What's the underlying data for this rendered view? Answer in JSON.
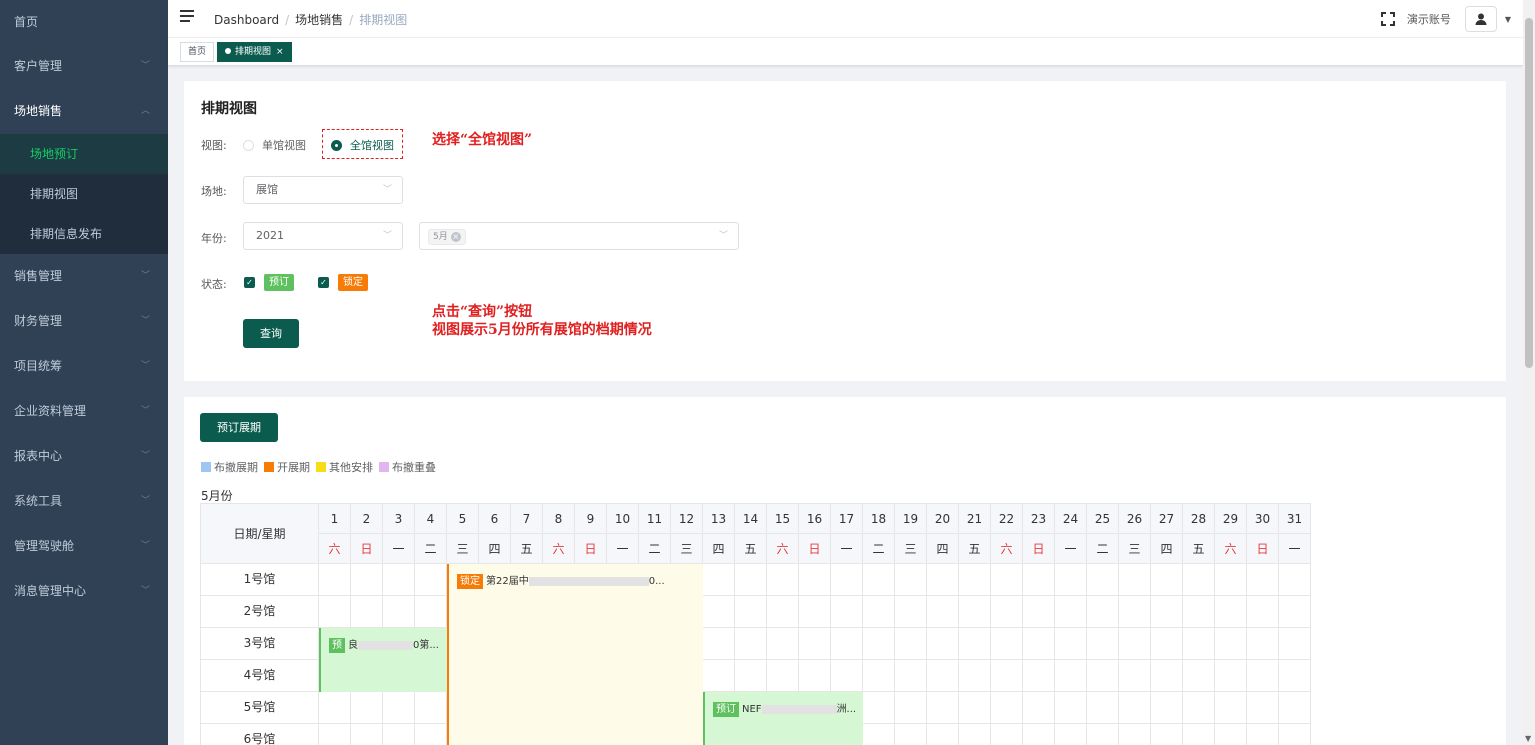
{
  "sidebar": {
    "items": [
      {
        "label": "首页",
        "has_arrow": false
      },
      {
        "label": "客户管理",
        "has_arrow": true
      },
      {
        "label": "场地销售",
        "has_arrow": true,
        "open": true
      },
      {
        "label": "销售管理",
        "has_arrow": true
      },
      {
        "label": "财务管理",
        "has_arrow": true
      },
      {
        "label": "项目统筹",
        "has_arrow": true
      },
      {
        "label": "企业资料管理",
        "has_arrow": true
      },
      {
        "label": "报表中心",
        "has_arrow": true
      },
      {
        "label": "系统工具",
        "has_arrow": true
      },
      {
        "label": "管理驾驶舱",
        "has_arrow": true
      },
      {
        "label": "消息管理中心",
        "has_arrow": true
      }
    ],
    "submenu": [
      "场地预订",
      "排期视图",
      "排期信息发布"
    ],
    "active_sub": "场地预订"
  },
  "header": {
    "breadcrumb": [
      "Dashboard",
      "场地销售",
      "排期视图"
    ],
    "account": "演示账号"
  },
  "tags": [
    {
      "label": "首页",
      "active": false
    },
    {
      "label": "排期视图",
      "active": true,
      "closable": "×"
    }
  ],
  "filter": {
    "title": "排期视图",
    "view_label": "视图:",
    "view_options": [
      "单馆视图",
      "全馆视图"
    ],
    "view_selected": "全馆视图",
    "annot_select": "选择“全馆视图”",
    "venue_label": "场地:",
    "venue_value": "展馆",
    "year_label": "年份:",
    "year_value": "2021",
    "month_chip": "5月",
    "status_label": "状态:",
    "status_options": [
      "预订",
      "锁定"
    ],
    "query_button": "查询",
    "annot_query_1": "点击“查询”按钮",
    "annot_query_2": "视图展示5月份所有展馆的档期情况",
    "colors": {
      "primary": "#0b5c4e",
      "booked": "#5ec05e",
      "locked": "#f77b07",
      "annotation": "#e02020"
    }
  },
  "schedule": {
    "book_button": "预订展期",
    "legend": [
      {
        "label": "布撤展期",
        "color": "#9ec6f0"
      },
      {
        "label": "开展期",
        "color": "#f77b07"
      },
      {
        "label": "其他安排",
        "color": "#f7dc1a"
      },
      {
        "label": "布撤重叠",
        "color": "#e5b3f0"
      }
    ],
    "month_label": "5月份",
    "corner_label": "日期/星期",
    "days": [
      "1",
      "2",
      "3",
      "4",
      "5",
      "6",
      "7",
      "8",
      "9",
      "10",
      "11",
      "12",
      "13",
      "14",
      "15",
      "16",
      "17",
      "18",
      "19",
      "20",
      "21",
      "22",
      "23",
      "24",
      "25",
      "26",
      "27",
      "28",
      "29",
      "30",
      "31"
    ],
    "weekdays": [
      "六",
      "日",
      "一",
      "二",
      "三",
      "四",
      "五",
      "六",
      "日",
      "一",
      "二",
      "三",
      "四",
      "五",
      "六",
      "日",
      "一",
      "二",
      "三",
      "四",
      "五",
      "六",
      "日",
      "一",
      "二",
      "三",
      "四",
      "五",
      "六",
      "日",
      "一"
    ],
    "venues": [
      "1号馆",
      "2号馆",
      "3号馆",
      "4号馆",
      "5号馆",
      "6号馆"
    ],
    "bookings": [
      {
        "tag": "锁定",
        "text_start": "第22届中",
        "text_end": "0...",
        "type": "locked"
      },
      {
        "tag": "预",
        "text_start": "良",
        "text_end": "0第...",
        "type": "booked"
      },
      {
        "tag": "预订",
        "text_start": "NEF",
        "text_end": "洲...",
        "type": "booked"
      }
    ]
  }
}
